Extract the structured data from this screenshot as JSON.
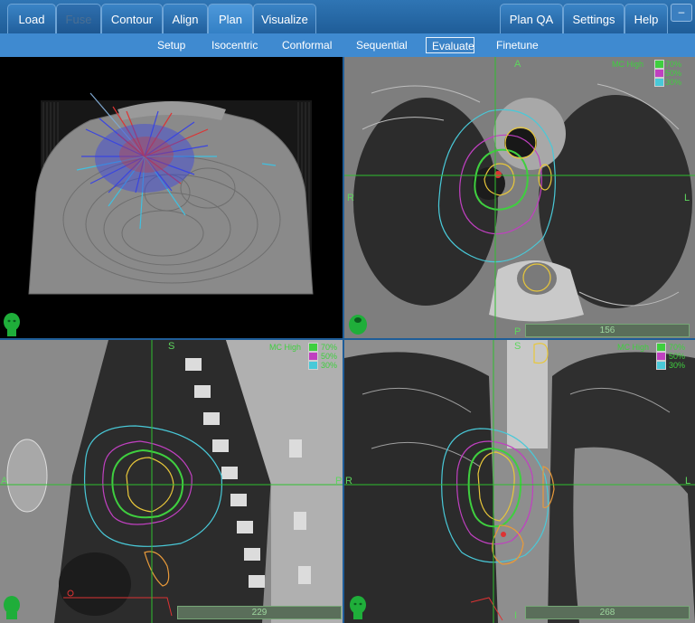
{
  "tabs": {
    "load": "Load",
    "fuse": "Fuse",
    "contour": "Contour",
    "align": "Align",
    "plan": "Plan",
    "visualize": "Visualize",
    "plan_qa": "Plan QA",
    "settings": "Settings",
    "help": "Help"
  },
  "window": {
    "minimize": "–"
  },
  "subtabs": {
    "setup": "Setup",
    "isocentric": "Isocentric",
    "conformal": "Conformal",
    "sequential": "Sequential",
    "evaluate": "Evaluate",
    "finetune": "Finetune"
  },
  "legend": {
    "mode": "MC High",
    "toggle": "P",
    "l70": "70%",
    "l50": "50%",
    "l30": "30%"
  },
  "colors": {
    "iso70": "#3fcf3f",
    "iso50": "#c040c0",
    "iso30": "#49c9d8",
    "contour": "#e8c73a",
    "crosshair": "#2fbf2f"
  },
  "axial": {
    "top": "A",
    "bottom": "P",
    "left": "R",
    "right": "L",
    "slice": "156"
  },
  "sagittal": {
    "top": "S",
    "left": "A",
    "right": "P",
    "slice": "229"
  },
  "coronal": {
    "top": "S",
    "left": "R",
    "right": "L",
    "bottom": "I",
    "slice": "268"
  }
}
